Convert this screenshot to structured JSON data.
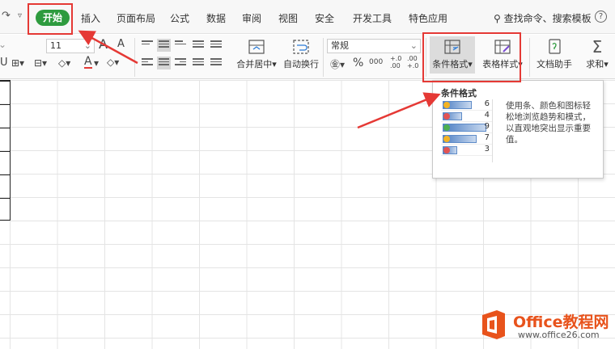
{
  "menu": {
    "tabs": [
      "开始",
      "插入",
      "页面布局",
      "公式",
      "数据",
      "审阅",
      "视图",
      "安全",
      "开发工具",
      "特色应用"
    ],
    "search": "查找命令、搜索模板",
    "help": "?"
  },
  "ribbon": {
    "font_size": "11",
    "number_format": "常规",
    "merge_center": "合并居中",
    "auto_wrap": "自动换行",
    "conditional_format": "条件格式",
    "table_style": "表格样式",
    "doc_assistant": "文档助手",
    "sum": "求和",
    "grow_font": "A",
    "shrink_font": "A",
    "font_color": "A",
    "percent": "%",
    "comma": "000",
    "inc_decimal": "+.0 .00",
    "dec_decimal": ".00 +.0"
  },
  "tooltip": {
    "title": "条件格式",
    "values": [
      "6",
      "4",
      "9",
      "7",
      "3"
    ],
    "description": "使用条、颜色和图标轻松地浏览趋势和模式，以直观地突出显示重要值。"
  },
  "watermark": {
    "name": "Office教程网",
    "url": "www.office26.com"
  },
  "colors": {
    "start_tab": "#2e9b3e",
    "annotation": "#e53935",
    "watermark": "#e8531c"
  }
}
